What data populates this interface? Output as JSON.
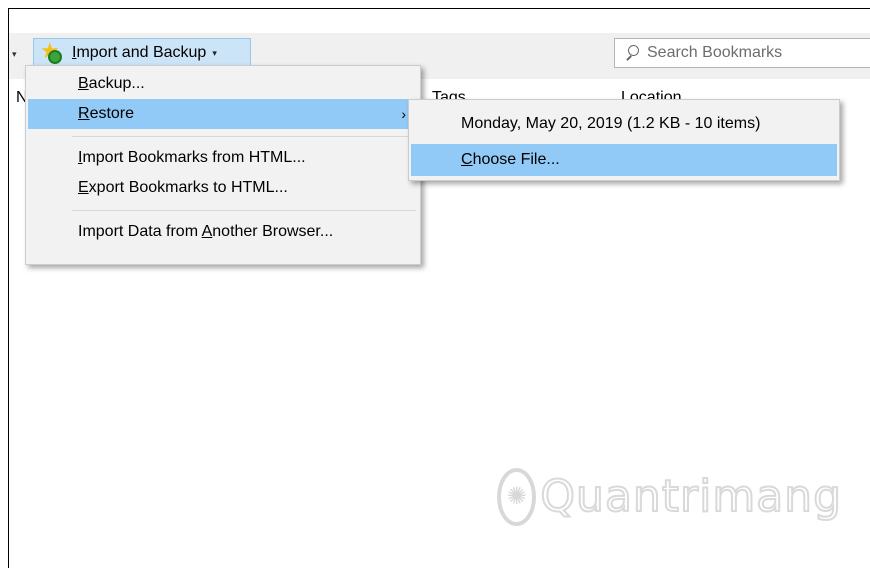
{
  "toolbar": {
    "left_dropdown_arrow": "▾",
    "import_backup": {
      "underlined_letter": "I",
      "label_rest": "mport and Backup",
      "caret": "▾",
      "icon": "star-refresh-icon"
    },
    "search": {
      "placeholder": "Search Bookmarks",
      "icon": "search-icon"
    }
  },
  "columns": {
    "name_truncated": "N",
    "tags": "Tags",
    "location": "Location"
  },
  "menu": {
    "items": [
      {
        "u": "B",
        "rest": "ackup..."
      },
      {
        "u": "R",
        "rest": "estore",
        "submenu_arrow": "›",
        "selected": true
      },
      {
        "pre": "",
        "u": "I",
        "rest": "mport Bookmarks from HTML..."
      },
      {
        "u": "E",
        "rest": "xport Bookmarks to HTML..."
      },
      {
        "pre": "Import Data from ",
        "u": "A",
        "rest": "nother Browser..."
      }
    ]
  },
  "submenu": {
    "items": [
      {
        "label": "Monday, May 20, 2019 (1.2 KB - 10 items)"
      },
      {
        "u": "C",
        "rest": "hoose File...",
        "selected": true
      }
    ]
  },
  "watermark": {
    "logo_text": "Quantrimang"
  },
  "colors": {
    "toolbar_bg": "#f0f0f0",
    "button_highlight": "#cce4f7",
    "menu_bg": "#f2f2f2",
    "selection": "#91c9f7"
  }
}
